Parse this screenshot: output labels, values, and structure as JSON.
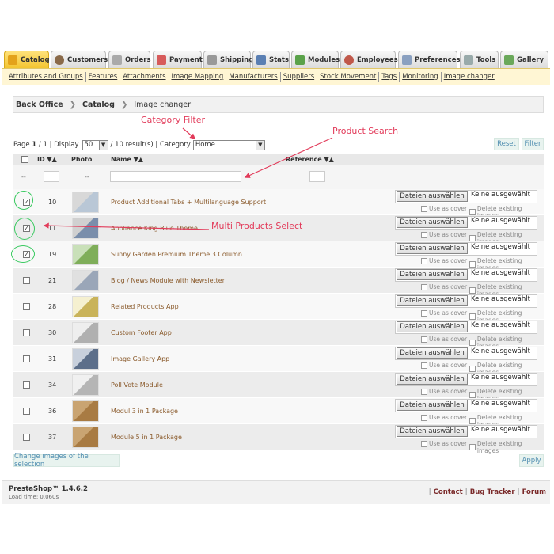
{
  "tabs": [
    {
      "label": "Catalog",
      "icon": "folder-icon",
      "active": true
    },
    {
      "label": "Customers",
      "icon": "customers-icon",
      "active": false
    },
    {
      "label": "Orders",
      "icon": "orders-icon",
      "active": false
    },
    {
      "label": "Payment",
      "icon": "payment-icon",
      "active": false
    },
    {
      "label": "Shipping",
      "icon": "truck-icon",
      "active": false
    },
    {
      "label": "Stats",
      "icon": "stats-icon",
      "active": false
    },
    {
      "label": "Modules",
      "icon": "modules-icon",
      "active": false
    },
    {
      "label": "Employees",
      "icon": "employees-icon",
      "active": false
    },
    {
      "label": "Preferences",
      "icon": "preferences-icon",
      "active": false
    },
    {
      "label": "Tools",
      "icon": "tools-icon",
      "active": false
    },
    {
      "label": "Gallery",
      "icon": "gallery-icon",
      "active": false
    }
  ],
  "submenu": [
    "Attributes and Groups",
    "Features",
    "Attachments",
    "Image Mapping",
    "Manufacturers",
    "Suppliers",
    "Stock Movement",
    "Tags",
    "Monitoring",
    "Image changer"
  ],
  "breadcrumb": {
    "items": [
      "Back Office",
      "Catalog",
      "Image changer"
    ]
  },
  "toolbar": {
    "page_prefix": "Page",
    "page_value": "1",
    "page_sep": "/",
    "page_total": "1",
    "display_label": "| Display",
    "display_value": "50",
    "results_text": "/ 10 result(s) | Category",
    "category_value": "Home",
    "reset_label": "Reset",
    "filter_label": "Filter"
  },
  "table": {
    "headers": {
      "id": "ID",
      "photo": "Photo",
      "name": "Name",
      "reference": "Reference"
    },
    "filter_placeholder": "--",
    "file_button": "Dateien auswählen",
    "file_status": "Keine ausgewählt",
    "use_as_cover": "Use as cover",
    "delete_images": "Delete existing images",
    "rows": [
      {
        "id": "10",
        "name": "Product Additional Tabs + Multilanguage Support",
        "checked": true
      },
      {
        "id": "11",
        "name": "Appliance King Blue Theme",
        "checked": true
      },
      {
        "id": "19",
        "name": "Sunny Garden Premium Theme 3 Column",
        "checked": true
      },
      {
        "id": "21",
        "name": "Blog / News Module with Newsletter",
        "checked": false
      },
      {
        "id": "28",
        "name": "Related Products App",
        "checked": false
      },
      {
        "id": "30",
        "name": "Custom Footer App",
        "checked": false
      },
      {
        "id": "31",
        "name": "Image Gallery App",
        "checked": false
      },
      {
        "id": "34",
        "name": "Poll Vote Module",
        "checked": false
      },
      {
        "id": "36",
        "name": "Modul 3 in 1 Package",
        "checked": false
      },
      {
        "id": "37",
        "name": "Module 5 in 1 Package",
        "checked": false
      }
    ]
  },
  "actions": {
    "change_selection": "Change images of the selection",
    "apply": "Apply"
  },
  "footer": {
    "version": "PrestaShop™ 1.4.6.2",
    "load_time": "Load time: 0.060s",
    "links": [
      "Contact",
      "Bug Tracker",
      "Forum"
    ]
  },
  "annotations": {
    "category_filter": "Category Filter",
    "product_search": "Product Search",
    "multi_select": "Multi Products Select"
  },
  "colors": {
    "annotation": "#e23b5a",
    "circle": "#38c95f",
    "active_tab": "#f3c531",
    "link_blue": "#4f8db0",
    "product_name": "#8a5a2b"
  }
}
